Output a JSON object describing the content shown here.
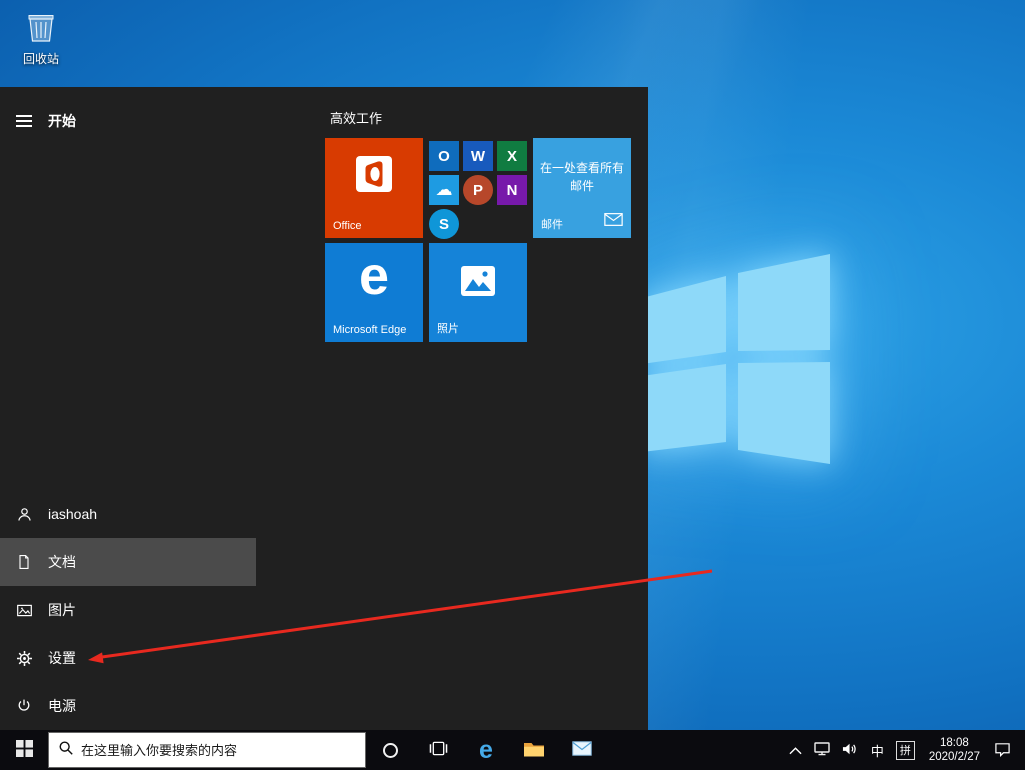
{
  "desktop": {
    "recycle_bin_label": "回收站"
  },
  "start_menu": {
    "header_label": "开始",
    "group_title": "高效工作",
    "sidebar": {
      "user": "iashoah",
      "documents": "文档",
      "pictures": "图片",
      "settings": "设置",
      "power": "电源"
    },
    "tiles": {
      "office_label": "Office",
      "mail_line1": "在一处查看所有",
      "mail_line2": "邮件",
      "mail_label": "邮件",
      "edge_letter": "e",
      "edge_label": "Microsoft Edge",
      "photos_label": "照片"
    },
    "office_apps": [
      {
        "name": "outlook",
        "letter": "O"
      },
      {
        "name": "word",
        "letter": "W"
      },
      {
        "name": "excel",
        "letter": "X"
      },
      {
        "name": "onedrive",
        "letter": "☁"
      },
      {
        "name": "powerpoint",
        "letter": "P"
      },
      {
        "name": "onenote",
        "letter": "N"
      },
      {
        "name": "skype",
        "letter": "S"
      }
    ]
  },
  "taskbar": {
    "search_placeholder": "在这里输入你要搜索的内容",
    "edge_letter": "e",
    "tray": {
      "ime_lang": "中",
      "ime_mode": "拼",
      "time": "18:08",
      "date": "2020/2/27"
    }
  },
  "icons": {
    "start": "windows-logo",
    "hamburger": "hamburger-menu",
    "user": "user-avatar",
    "documents": "document-page",
    "pictures": "picture-frame",
    "settings": "gear",
    "power": "power-symbol",
    "search": "magnifier",
    "cortana": "circle-ring",
    "task_view": "task-view-panels",
    "explorer": "yellow-folder",
    "mail": "envelope",
    "tray_up": "chevron-up",
    "network": "display-network",
    "volume": "speaker-waves",
    "action_center": "speech-bubble",
    "recycle_bin": "trash-bin",
    "wallpaper_logo": "windows-window-glow"
  },
  "colors": {
    "accent_blue": "#0f7cd4",
    "mail_tile_blue": "#38a1e0",
    "photos_blue": "#1583d8",
    "office_red": "#d83b01",
    "menu_bg": "#202020",
    "taskbar_bg": "#0b0b0f",
    "sidebar_highlight": "#4b4b4b",
    "arrow_red": "#e8291f"
  }
}
